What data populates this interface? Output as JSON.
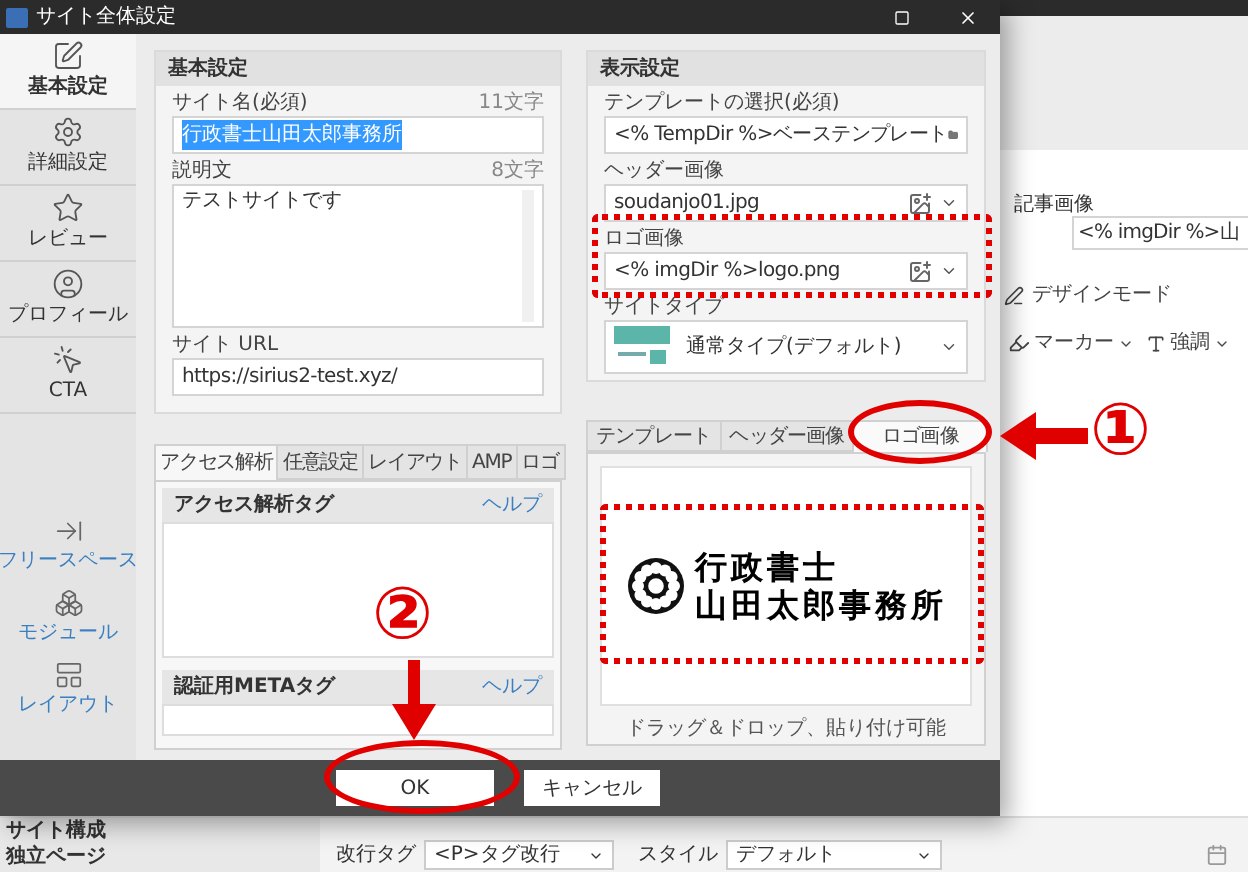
{
  "window": {
    "title": "サイト全体設定"
  },
  "sidebar": {
    "items": [
      {
        "label": "基本設定",
        "selected": true
      },
      {
        "label": "詳細設定",
        "selected": false
      },
      {
        "label": "レビュー",
        "selected": false
      },
      {
        "label": "プロフィール",
        "selected": false
      },
      {
        "label": "CTA",
        "selected": false
      }
    ],
    "tools": [
      {
        "label": "フリースペース"
      },
      {
        "label": "モジュール"
      },
      {
        "label": "レイアウト"
      }
    ]
  },
  "basic_settings": {
    "title": "基本設定",
    "site_name": {
      "label": "サイト名(必須)",
      "count": "11文字",
      "value": "行政書士山田太郎事務所",
      "selected": true
    },
    "description": {
      "label": "説明文",
      "count": "8文字",
      "value": "テストサイトです"
    },
    "site_url": {
      "label": "サイト URL",
      "value": "https://sirius2-test.xyz/"
    }
  },
  "display_settings": {
    "title": "表示設定",
    "template": {
      "label": "テンプレートの選択(必須)",
      "value": "<% TempDir %>ベーステンプレート"
    },
    "header_image": {
      "label": "ヘッダー画像",
      "value": "soudanjo01.jpg"
    },
    "logo_image": {
      "label": "ロゴ画像",
      "value": "<% imgDir %>logo.png"
    },
    "site_type": {
      "label": "サイトタイプ",
      "value": "通常タイプ(デフォルト)"
    }
  },
  "lower_tabs": {
    "tabs": [
      {
        "label": "アクセス解析",
        "selected": true
      },
      {
        "label": "任意設定",
        "selected": false
      },
      {
        "label": "レイアウト",
        "selected": false
      },
      {
        "label": "AMP",
        "selected": false
      },
      {
        "label": "ロゴ",
        "selected": false
      }
    ],
    "sections": [
      {
        "title": "アクセス解析タグ",
        "help": "ヘルプ"
      },
      {
        "title": "認証用METAタグ",
        "help": "ヘルプ"
      }
    ]
  },
  "preview": {
    "tabs": [
      {
        "label": "テンプレート",
        "selected": false
      },
      {
        "label": "ヘッダー画像",
        "selected": false
      },
      {
        "label": "ロゴ画像",
        "selected": true
      }
    ],
    "logo_lines": [
      "行政書士",
      "山田太郎事務所"
    ],
    "hint": "ドラッグ＆ドロップ、貼り付け可能"
  },
  "buttons": [
    {
      "label": "OK"
    },
    {
      "label": "キャンセル"
    }
  ],
  "annotations": {
    "step_1": "①",
    "step_2": "②"
  },
  "background_app": {
    "article_image": {
      "label": "記事画像",
      "value": "<% imgDir %>山"
    },
    "design_mode": "デザインモード",
    "marker": "マーカー",
    "emphasis": "強調",
    "nav": [
      "サイト構成",
      "独立ページ"
    ],
    "line_break": {
      "label": "改行タグ",
      "value": "<P>タグ改行"
    },
    "style": {
      "label": "スタイル",
      "value": "デフォルト"
    }
  }
}
